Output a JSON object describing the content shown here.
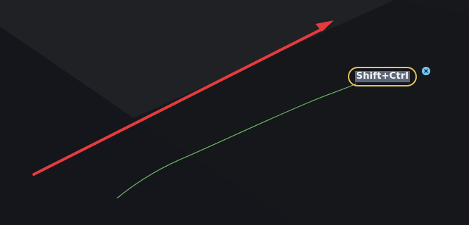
{
  "annotation": {
    "shortcut_label": "Shift+Ctrl",
    "arrow_color": "#e63b3e",
    "trail_color": "#6db866",
    "badge_border_color": "#e3c45b",
    "close_color": "#76c8f4",
    "close_icon": "close-icon"
  }
}
